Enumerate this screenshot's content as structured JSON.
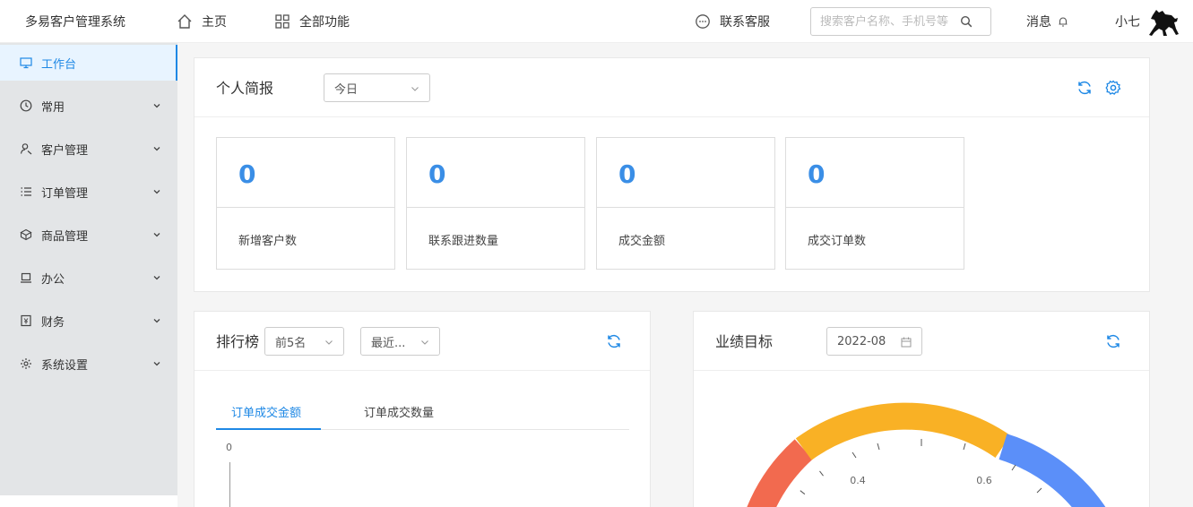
{
  "topbar": {
    "brand": "多易客户管理系统",
    "home_label": "主页",
    "all_label": "全部功能",
    "service_label": "联系客服",
    "search_placeholder": "搜索客户名称、手机号等",
    "message_label": "消息",
    "user_name": "小七"
  },
  "sidebar": {
    "items": [
      {
        "label": "工作台",
        "icon": "monitor-icon"
      },
      {
        "label": "常用",
        "icon": "clock-icon"
      },
      {
        "label": "客户管理",
        "icon": "customer-icon"
      },
      {
        "label": "订单管理",
        "icon": "list-icon"
      },
      {
        "label": "商品管理",
        "icon": "cube-icon"
      },
      {
        "label": "办公",
        "icon": "laptop-icon"
      },
      {
        "label": "财务",
        "icon": "finance-icon"
      },
      {
        "label": "系统设置",
        "icon": "gear-icon"
      }
    ]
  },
  "report": {
    "title": "个人简报",
    "period": "今日",
    "stats": [
      {
        "value": "0",
        "label": "新增客户数"
      },
      {
        "value": "0",
        "label": "联系跟进数量"
      },
      {
        "value": "0",
        "label": "成交金额"
      },
      {
        "value": "0",
        "label": "成交订单数"
      }
    ]
  },
  "ranking": {
    "title": "排行榜",
    "top_select": "前5名",
    "range_select": "最近...",
    "tabs": [
      "订单成交金额",
      "订单成交数量"
    ],
    "axis_zero": "0"
  },
  "target": {
    "title": "业绩目标",
    "month": "2022-08",
    "gauge_labels": [
      "0.4",
      "0.6"
    ]
  },
  "colors": {
    "accent": "#1e88e5",
    "gauge_red": "#f26a4f",
    "gauge_yellow": "#f9b125",
    "gauge_blue": "#5b8ff9"
  }
}
